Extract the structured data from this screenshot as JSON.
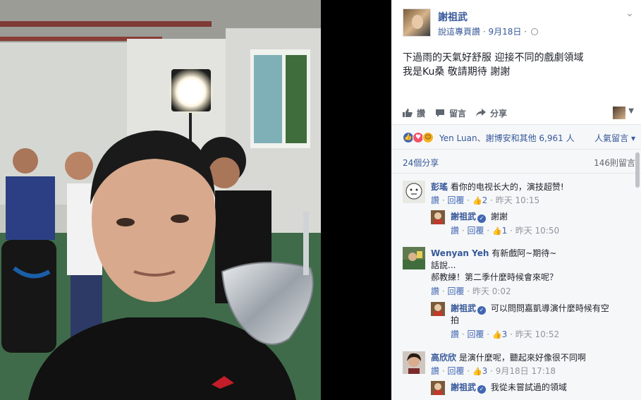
{
  "post": {
    "page_name": "謝祖武",
    "meta_like_page": "說這專頁讚",
    "meta_sep": " · ",
    "meta_date": "9月18日",
    "meta_sep2": " · ",
    "text_lines": [
      "下過雨的天氣好舒服 迎接不同的戲劇領域",
      "我是Ku桑 敬請期待 謝謝"
    ]
  },
  "actions": {
    "like": "讚",
    "comment": "留言",
    "share": "分享"
  },
  "reactions": {
    "first_name": "Yen Luan",
    "separator": "、",
    "others": "謝博安和其他 6,961 人",
    "sort_label": "人氣留言"
  },
  "counts": {
    "shares": "24個分享",
    "comments": "146則留言"
  },
  "comments": [
    {
      "name": "彭瑤",
      "text": "看你的电视长大的，演技超赞!",
      "like": "讚",
      "reply": "回覆",
      "likes": "2",
      "time": "昨天 10:15",
      "reply_item": {
        "name": "謝祖武",
        "text": "謝謝",
        "like": "讚",
        "reply": "回覆",
        "likes": "1",
        "time": "昨天 10:50"
      }
    },
    {
      "name": "Wenyan Yeh",
      "text_lines": [
        "有新戲阿~期待~",
        "話說...",
        "郝教練！第二季什麼時候會來呢？"
      ],
      "like": "讚",
      "reply": "回覆",
      "time": "昨天 0:02",
      "reply_item": {
        "name": "謝祖武",
        "text_lines": [
          "可以問問嘉凱導演什麼時候有空",
          "拍"
        ],
        "like": "讚",
        "reply": "回覆",
        "likes": "3",
        "time": "昨天 10:52"
      }
    },
    {
      "name": "高欣欣",
      "text": "是演什麼呢，聽起來好像很不同啊",
      "like": "讚",
      "reply": "回覆",
      "likes": "3",
      "time": "9月18日 17:18",
      "reply_item": {
        "name": "謝祖武",
        "text": "我從未嘗試過的領域"
      }
    }
  ],
  "icons": {
    "globe": "globe-icon",
    "chevron": "chevron-down-icon",
    "like": "thumbs-up-icon",
    "comment": "comment-bubble-icon",
    "share": "share-arrow-icon",
    "verified": "verified-badge-icon"
  },
  "colors": {
    "link": "#365899",
    "accent": "#4267b2",
    "muted": "#90949c",
    "panel_bg": "#f6f7f9"
  }
}
